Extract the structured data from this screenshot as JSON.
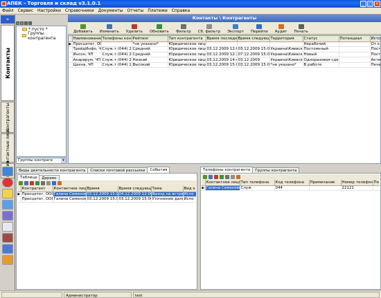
{
  "window": {
    "title": "АПЕК - Торговля и склад v3.1.0.1",
    "buttons": [
      "_",
      "□",
      "×"
    ]
  },
  "menu": [
    "Файл",
    "Сервис",
    "Настройки",
    "Справочники",
    "Документы",
    "Отчеты",
    "Платежи",
    "Справка"
  ],
  "left_strip": {
    "collapse_label": "»",
    "tabs": [
      {
        "label": "Контакты",
        "active": true
      },
      {
        "label": "Контрагенты",
        "active": false
      },
      {
        "label": "Контактные лица",
        "active": false
      },
      {
        "label": "События",
        "active": false
      }
    ],
    "icons": [
      "globe-icon",
      "no-entry-icon",
      "note-icon",
      "calendar-icon",
      "stack-icon",
      "copy-icon",
      "printer-icon",
      "books-icon",
      "people-icon"
    ]
  },
  "tree": {
    "items": [
      "* пусто *",
      "Группы контрагента"
    ],
    "combo_value": "Группы контраге"
  },
  "panel": {
    "header": "Контакты \\ Контрагенты"
  },
  "toolbar": [
    {
      "label": "Добавить",
      "icon": "add-icon",
      "color": "#5a8f2c"
    },
    {
      "label": "Изменить",
      "icon": "edit-icon",
      "color": "#4a70b8"
    },
    {
      "label": "Удалить",
      "icon": "delete-icon",
      "color": "#c0392b"
    },
    {
      "label": "Обновить",
      "icon": "refresh-icon",
      "color": "#3b8e3b"
    },
    {
      "label": "Фильтр",
      "icon": "filter-icon",
      "color": "#707070"
    },
    {
      "label": "Сб. фильтр",
      "icon": "clear-filter-icon",
      "color": "#909090"
    },
    {
      "label": "Экспорт",
      "icon": "export-icon",
      "color": "#3f7fbf"
    },
    {
      "label": "Перейти",
      "icon": "goto-icon",
      "color": "#2f6fcf"
    },
    {
      "label": "Аудит",
      "icon": "audit-icon",
      "color": "#d07020"
    },
    {
      "label": "Печать",
      "icon": "print-icon",
      "color": "#606060"
    }
  ],
  "contractors": {
    "columns": [
      "Наименование",
      "Телефоны контраг",
      "Рейтинг",
      "Тип контрагента",
      "Время последнего",
      "Время следующег",
      "Территория",
      "Статус",
      "Потенциал",
      "Источ"
    ],
    "rows": [
      [
        "Присцетег, ООО",
        "",
        "*не указано*",
        "Юридическое лицо",
        "",
        "",
        "",
        "Нерабочий",
        "",
        "От кл"
      ],
      [
        "ТрейдИнфо, ЧП",
        "Служ.т (044) 22112",
        "Средний",
        "Юридическое лицо",
        "03.12.2009 12:01:5",
        "03.12.2009 15:00:0",
        "Украина\\Киевска",
        "Постоянный",
        "",
        "Посто"
      ],
      [
        "Инсон, ЧП",
        "Служ.т (044) 21221",
        "Средний",
        "Юридическое лицо",
        "03.12.2009 12:28:5",
        "07.12.2009 15:00:0",
        "Украина\\Киевска",
        "Новый",
        "",
        "Посто"
      ],
      [
        "Акарирум, ЧП",
        "Служ.т (044) 23223",
        "Низкий",
        "Юридическое лицо",
        "03.12.2009 14:41:4",
        "03.12.2009",
        "Украина\\Киевска",
        "Одноразовая сдел",
        "",
        "Актив"
      ],
      [
        "Цахна, ЧП",
        "Служ.т (044) 12121",
        "Высокий",
        "Юридическое лицо",
        "03.12.2009 15:00:0",
        "03.12.2009 15:00:0",
        "*не указано*",
        "В работе",
        "",
        "Печат"
      ]
    ]
  },
  "bottom_left": {
    "tabs": [
      "Виды деятельности контрагента",
      "Списки почтовой рассылки",
      "События"
    ],
    "active_tab": 2,
    "subtabs": [
      "Таблица",
      "Дерево"
    ],
    "columns": [
      "Контрагент",
      "Контактное лицо",
      "Время",
      "Время следующег",
      "Тема",
      "Вид к"
    ],
    "rows": [
      [
        "Присцетег, ООО",
        "Галина Семеновна",
        "03.12.2009 15:00:0",
        "04.12.2009 12:00:0",
        "Выезд на встречу",
        "Испо"
      ],
      [
        "Присцетег, ООО",
        "Галина Семеновна",
        "03.12.2009 15:06:1",
        "03.12.2009 15:00:0",
        "Уточнение дальне",
        "Испо"
      ]
    ]
  },
  "bottom_right": {
    "tabs": [
      "Телефоны контрагента",
      "Группы контрагента"
    ],
    "active_tab": 0,
    "columns": [
      "Контактное лицо",
      "Тип телефона",
      "Код телефона",
      "Примечание",
      "Номер телефона",
      "По"
    ],
    "rows": [
      [
        "Галина Семеновна",
        "Служ",
        "044",
        "",
        "22121",
        ""
      ]
    ]
  },
  "statusbar": {
    "user": "Администратор",
    "db": "test"
  }
}
